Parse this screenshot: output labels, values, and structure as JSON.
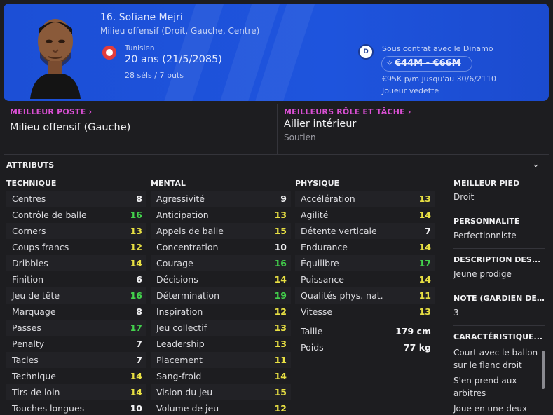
{
  "player": {
    "name": "16. Sofiane Mejri",
    "positions": "Milieu offensif (Droit, Gauche, Centre)",
    "nationality": "Tunisien",
    "age": "20 ans (21/5/2085)",
    "apps": "28 séls / 7 buts",
    "contract": "Sous contrat avec le Dinamo",
    "value": "€44M - €66M",
    "wage": "€95K p/m jusqu'au 30/6/2110",
    "status": "Joueur vedette",
    "club_badge_letter": "D"
  },
  "best": {
    "position_title": "MEILLEUR POSTE",
    "position_value": "Milieu offensif (Gauche)",
    "role_title": "MEILLEURS RÔLE ET TÂCHE",
    "role_value": "Ailier intérieur",
    "role_duty": "Soutien"
  },
  "attributes": {
    "title": "ATTRIBUTS",
    "technique_title": "TECHNIQUE",
    "mental_title": "MENTAL",
    "physique_title": "PHYSIQUE",
    "technique": [
      {
        "name": "Centres",
        "value": "8",
        "color": "white"
      },
      {
        "name": "Contrôle de balle",
        "value": "16",
        "color": "green"
      },
      {
        "name": "Corners",
        "value": "13",
        "color": "yellow"
      },
      {
        "name": "Coups francs",
        "value": "12",
        "color": "yellow"
      },
      {
        "name": "Dribbles",
        "value": "14",
        "color": "yellow"
      },
      {
        "name": "Finition",
        "value": "6",
        "color": "white"
      },
      {
        "name": "Jeu de tête",
        "value": "16",
        "color": "green"
      },
      {
        "name": "Marquage",
        "value": "8",
        "color": "white"
      },
      {
        "name": "Passes",
        "value": "17",
        "color": "green"
      },
      {
        "name": "Penalty",
        "value": "7",
        "color": "white"
      },
      {
        "name": "Tacles",
        "value": "7",
        "color": "white"
      },
      {
        "name": "Technique",
        "value": "14",
        "color": "yellow"
      },
      {
        "name": "Tirs de loin",
        "value": "14",
        "color": "yellow"
      },
      {
        "name": "Touches longues",
        "value": "10",
        "color": "white"
      }
    ],
    "mental": [
      {
        "name": "Agressivité",
        "value": "9",
        "color": "white"
      },
      {
        "name": "Anticipation",
        "value": "13",
        "color": "yellow"
      },
      {
        "name": "Appels de balle",
        "value": "15",
        "color": "yellow"
      },
      {
        "name": "Concentration",
        "value": "10",
        "color": "white"
      },
      {
        "name": "Courage",
        "value": "16",
        "color": "green"
      },
      {
        "name": "Décisions",
        "value": "14",
        "color": "yellow"
      },
      {
        "name": "Détermination",
        "value": "19",
        "color": "green"
      },
      {
        "name": "Inspiration",
        "value": "12",
        "color": "yellow"
      },
      {
        "name": "Jeu collectif",
        "value": "13",
        "color": "yellow"
      },
      {
        "name": "Leadership",
        "value": "13",
        "color": "yellow"
      },
      {
        "name": "Placement",
        "value": "11",
        "color": "yellow"
      },
      {
        "name": "Sang-froid",
        "value": "14",
        "color": "yellow"
      },
      {
        "name": "Vision du jeu",
        "value": "15",
        "color": "yellow"
      },
      {
        "name": "Volume de jeu",
        "value": "12",
        "color": "yellow"
      }
    ],
    "physique": [
      {
        "name": "Accélération",
        "value": "13",
        "color": "yellow"
      },
      {
        "name": "Agilité",
        "value": "14",
        "color": "yellow"
      },
      {
        "name": "Détente verticale",
        "value": "7",
        "color": "white"
      },
      {
        "name": "Endurance",
        "value": "14",
        "color": "yellow"
      },
      {
        "name": "Équilibre",
        "value": "17",
        "color": "green"
      },
      {
        "name": "Puissance",
        "value": "14",
        "color": "yellow"
      },
      {
        "name": "Qualités phys. nat.",
        "value": "11",
        "color": "yellow"
      },
      {
        "name": "Vitesse",
        "value": "13",
        "color": "yellow"
      }
    ],
    "height_label": "Taille",
    "height_value": "179 cm",
    "weight_label": "Poids",
    "weight_value": "77 kg"
  },
  "side": {
    "foot_label": "MEILLEUR PIED",
    "foot_value": "Droit",
    "personality_label": "PERSONNALITÉ",
    "personality_value": "Perfectionniste",
    "description_label": "DESCRIPTION DES...",
    "description_value": "Jeune prodige",
    "note_label": "NOTE (GARDIEN DE...",
    "note_value": "3",
    "traits_label": "CARACTÉRISTIQUE...",
    "traits": [
      "Court avec le ballon sur le flanc droit",
      "S'en prend aux arbitres",
      "Joue en une-deux"
    ]
  },
  "colors": {
    "header_blue": "#1e54dd",
    "accent_pink": "#d94fd3",
    "attr_green": "#43d24c",
    "attr_yellow": "#e8e043",
    "attr_white": "#f2f2f4"
  }
}
